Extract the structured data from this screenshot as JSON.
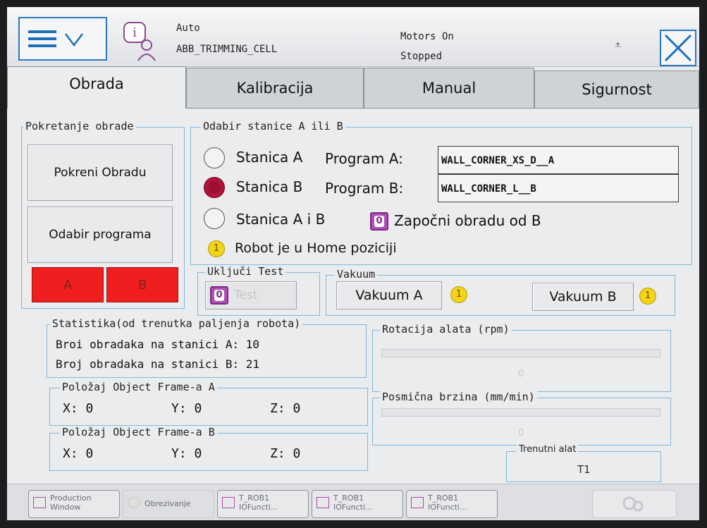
{
  "header": {
    "mode": "Auto",
    "system_name": "ABB_TRIMMING_CELL",
    "motors": "Motors On",
    "state": "Stopped"
  },
  "tabs": [
    {
      "label": "Obrada"
    },
    {
      "label": "Kalibracija"
    },
    {
      "label": "Manual"
    },
    {
      "label": "Sigurnost"
    }
  ],
  "pokretanje": {
    "legend": "Pokretanje obrade",
    "start_button": "Pokreni Obradu",
    "program_button": "Odabir programa",
    "btn_a": "A",
    "btn_b": "B"
  },
  "stanica": {
    "legend": "Odabir stanice A ili B",
    "options": [
      {
        "label": "Stanica A",
        "selected": false
      },
      {
        "label": "Stanica B",
        "selected": true
      },
      {
        "label": "Stanica A i B",
        "selected": false
      }
    ],
    "program_a_label": "Program A:",
    "program_a_value": "WALL_CORNER_XS_D__A",
    "program_b_label": "Program B:",
    "program_b_value": "WALL_CORNER_L__B",
    "zapocni_badge": "0",
    "zapocni_label": "Započni obradu od B",
    "home_badge": "1",
    "home_label": "Robot je u Home poziciji"
  },
  "test": {
    "legend": "Uključi Test",
    "badge": "0",
    "label": "Test"
  },
  "vakuum": {
    "legend": "Vakuum",
    "a_button": "Vakuum A",
    "a_badge": "1",
    "b_button": "Vakuum B",
    "b_badge": "1"
  },
  "statistika": {
    "legend": "Statistika(od trenutka paljenja robota)",
    "line_a": "Broi obradaka na stanici A: 10",
    "line_b": "Broj obradaka na stanici B: 21"
  },
  "rotacija": {
    "legend": "Rotacija alata (rpm)",
    "value": "0"
  },
  "frame_a": {
    "legend": "Položaj Object Frame-a A",
    "x": "X:  0",
    "y": "Y: 0",
    "z": "Z:  0"
  },
  "frame_b": {
    "legend": "Položaj Object Frame-a B",
    "x": "X:  0",
    "y": "Y: 0",
    "z": "Z:  0"
  },
  "posmicna": {
    "legend": "Posmična brzina (mm/min)",
    "value": "0"
  },
  "alat": {
    "legend": "Trenutni alat",
    "value": "T1"
  },
  "taskbar": [
    {
      "line1": "Production",
      "line2": "Window"
    },
    {
      "line1": "Obrezivanje",
      "line2": ""
    },
    {
      "line1": "T_ROB1",
      "line2": "IOFuncti..."
    },
    {
      "line1": "T_ROB1",
      "line2": "IOFuncti..."
    },
    {
      "line1": "T_ROB1",
      "line2": "IOFuncti..."
    }
  ],
  "colors": {
    "accent_blue": "#2a79c4",
    "red_button": "#f01e1e",
    "radio_selected": "#b4123a",
    "badge_purple": "#b04fb6",
    "badge_yellow": "#f3d41a"
  }
}
